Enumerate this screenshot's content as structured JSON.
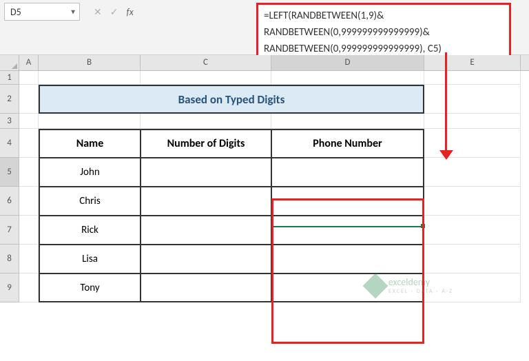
{
  "nameBox": {
    "value": "D5"
  },
  "formulaBar": {
    "line1": "=LEFT(RANDBETWEEN(1,9)&",
    "line2": "RANDBETWEEN(0,999999999999999)&",
    "line3": "RANDBETWEEN(0,999999999999999), C5)"
  },
  "columns": {
    "A": "A",
    "B": "B",
    "C": "C",
    "D": "D",
    "E": "E"
  },
  "rowNums": {
    "r1": "1",
    "r2": "2",
    "r3": "3",
    "r4": "4",
    "r5": "5",
    "r6": "6",
    "r7": "7",
    "r8": "8",
    "r9": "9"
  },
  "title": "Based on Typed Digits",
  "headers": {
    "name": "Name",
    "digits": "Number of Digits",
    "phone": "Phone Number"
  },
  "names": {
    "r5": "John",
    "r6": "Chris",
    "r7": "Rick",
    "r8": "Lisa",
    "r9": "Tony"
  },
  "watermark": {
    "brand": "exceldemy",
    "tagline": "EXCEL · DATA · A-Z"
  }
}
